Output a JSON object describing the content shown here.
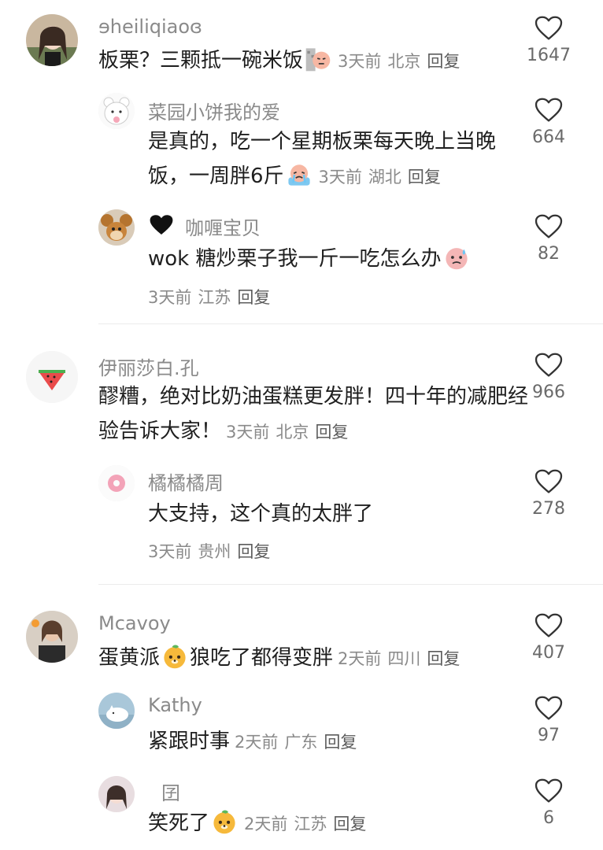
{
  "comments": [
    {
      "username": "ɘheiliqiaoɞ",
      "text": "板栗？三颗抵一碗米饭",
      "time": "3天前",
      "location": "北京",
      "reply": "回复",
      "likes": "1647",
      "emoji": "blocked-face-emoji",
      "avatar": "girl-photo-avatar"
    },
    {
      "username": "菜园小饼我的爱",
      "text": "是真的，吃一个星期板栗每天晚上当晚饭，一周胖6斤",
      "time": "3天前",
      "location": "湖北",
      "reply": "回复",
      "likes": "664",
      "emoji": "crying-emoji",
      "avatar": "bear-cartoon-avatar"
    },
    {
      "username": "咖喱宝贝",
      "text": "wok 糖炒栗子我一斤一吃怎么办",
      "time": "3天前",
      "location": "江苏",
      "reply": "回复",
      "likes": "82",
      "emoji": "sweat-emoji",
      "avatar": "jerry-mouse-avatar"
    },
    {
      "username": "伊丽莎白.孔",
      "text": "醪糟，绝对比奶油蛋糕更发胖！四十年的减肥经验告诉大家！",
      "time": "3天前",
      "location": "北京",
      "reply": "回复",
      "likes": "966",
      "avatar": "watermelon-avatar"
    },
    {
      "username": "橘橘橘周",
      "text": "大支持，这个真的太胖了",
      "time": "3天前",
      "location": "贵州",
      "reply": "回复",
      "likes": "278",
      "avatar": "donut-avatar"
    },
    {
      "username": "Mcavoy",
      "text_before": "蛋黄派",
      "text_after": "狼吃了都得变胖",
      "time": "2天前",
      "location": "四川",
      "reply": "回复",
      "likes": "407",
      "emoji": "orange-dog-emoji",
      "avatar": "woman-photo-avatar"
    },
    {
      "username": "Kathy",
      "text": "紧跟时事",
      "time": "2天前",
      "location": "广东",
      "reply": "回复",
      "likes": "97",
      "avatar": "cat-cartoon-avatar"
    },
    {
      "username": "囝",
      "text": "笑死了",
      "time": "2天前",
      "location": "江苏",
      "reply": "回复",
      "likes": "6",
      "emoji": "orange-dog-emoji",
      "avatar": "girl-photo-avatar-2"
    }
  ],
  "colors": {
    "text": "#1f1f1f",
    "muted": "#8a8a8a",
    "divider": "#ececec"
  },
  "icons": {
    "like": "heart-outline-icon",
    "badge": "black-heart-icon"
  }
}
